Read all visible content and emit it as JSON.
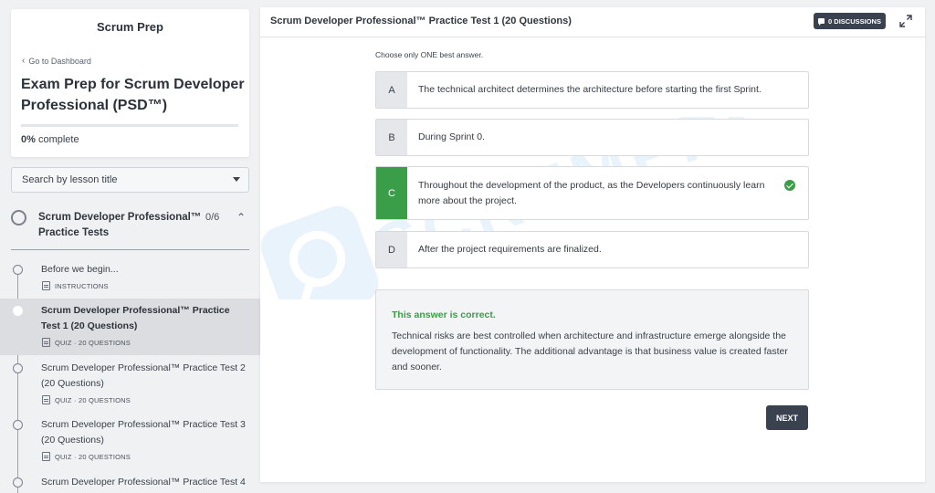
{
  "sidebar": {
    "brand": "Scrum Prep",
    "back_link": "Go to Dashboard",
    "course_title": "Exam Prep for Scrum Developer Professional (PSD™)",
    "progress": {
      "percent_label": "0%",
      "suffix": "complete",
      "fraction": 0
    },
    "search_placeholder": "Search by lesson title",
    "section": {
      "title": "Scrum Developer Professional™ Practice Tests",
      "count": "0/6"
    },
    "lessons": [
      {
        "title": "Before we begin...",
        "meta": "INSTRUCTIONS",
        "active": false
      },
      {
        "title": "Scrum Developer Professional™ Practice Test 1 (20 Questions)",
        "meta": "QUIZ · 20 QUESTIONS",
        "active": true
      },
      {
        "title": "Scrum Developer Professional™ Practice Test 2 (20 Questions)",
        "meta": "QUIZ · 20 QUESTIONS",
        "active": false
      },
      {
        "title": "Scrum Developer Professional™ Practice Test 3 (20 Questions)",
        "meta": "QUIZ · 20 QUESTIONS",
        "active": false
      },
      {
        "title": "Scrum Developer Professional™ Practice Test 4",
        "meta": "",
        "active": false
      }
    ]
  },
  "main": {
    "title": "Scrum Developer Professional™ Practice Test 1 (20 Questions)",
    "discussions_label": "0 DISCUSSIONS",
    "instruction": "Choose only ONE best answer.",
    "options": [
      {
        "letter": "A",
        "text": "The technical architect determines the architecture before starting the first Sprint.",
        "correct": false
      },
      {
        "letter": "B",
        "text": "During Sprint 0.",
        "correct": false
      },
      {
        "letter": "C",
        "text": "Throughout the development of the product, as the Developers continuously learn more about the project.",
        "correct": true
      },
      {
        "letter": "D",
        "text": "After the project requirements are finalized.",
        "correct": false
      }
    ],
    "feedback": {
      "title": "This answer is correct.",
      "body": "Technical risks are best controlled when architecture and infrastructure emerge alongside the development of functionality. The additional advantage is that business value is created faster and sooner."
    },
    "next_label": "NEXT",
    "watermark": "SCRUMPREP"
  },
  "colors": {
    "correct_green": "#3a9d48",
    "dark_button": "#3a414f",
    "watermark_blue": "#5aa6e6"
  },
  "icons": {
    "back": "chevron-left-icon",
    "select": "caret-down-icon",
    "section_toggle": "chevron-up-icon",
    "discussions": "chat-bubble-icon",
    "expand": "expand-icon",
    "correct": "check-circle-icon",
    "lesson_instructions": "document-icon",
    "lesson_quiz": "quiz-icon"
  }
}
